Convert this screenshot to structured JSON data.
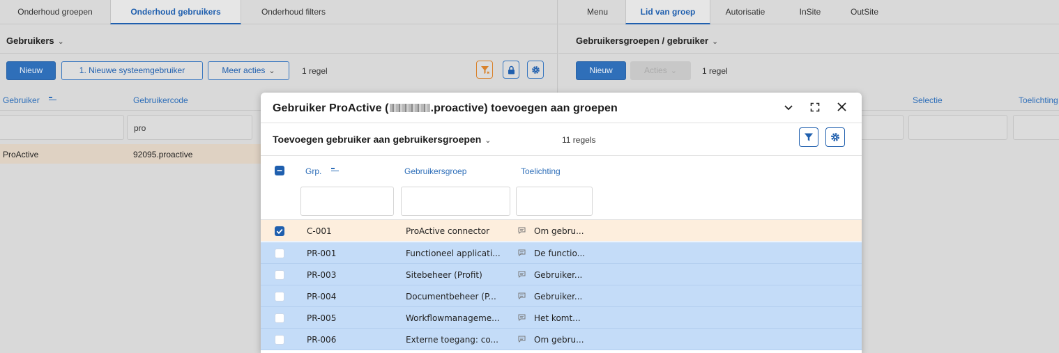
{
  "left_pane": {
    "tabs": [
      "Onderhoud groepen",
      "Onderhoud gebruikers",
      "Onderhoud filters"
    ],
    "active_tab": "Onderhoud gebruikers",
    "section_title": "Gebruikers",
    "toolbar": {
      "new_label": "Nieuw",
      "new_system_user_label": "1. Nieuwe systeemgebruiker",
      "more_actions_label": "Meer acties",
      "row_count": "1 regel"
    },
    "columns": [
      "Gebruiker",
      "Gebruikercode"
    ],
    "filter_value": "pro",
    "rows": [
      {
        "user": "ProActive",
        "code": "92095.proactive"
      }
    ]
  },
  "right_pane": {
    "tabs": [
      "Menu",
      "Lid van groep",
      "Autorisatie",
      "InSite",
      "OutSite"
    ],
    "active_tab": "Lid van groep",
    "section_title": "Gebruikersgroepen / gebruiker",
    "toolbar": {
      "new_label": "Nieuw",
      "actions_label": "Acties",
      "row_count": "1 regel"
    },
    "columns": [
      "Selectie",
      "Toelichting"
    ]
  },
  "modal": {
    "title_prefix": "Gebruiker ProActive (",
    "title_suffix": ".proactive) toevoegen aan groepen",
    "subtitle": "Toevoegen gebruiker aan gebruikersgroepen",
    "row_count": "11 regels",
    "columns": {
      "grp": "Grp.",
      "group": "Gebruikersgroep",
      "note": "Toelichting"
    },
    "rows": [
      {
        "grp": "C-001",
        "group": "ProActive connector",
        "note": "Om gebru...",
        "checked": true
      },
      {
        "grp": "PR-001",
        "group": "Functioneel applicati...",
        "note": "De functio...",
        "checked": false
      },
      {
        "grp": "PR-003",
        "group": "Sitebeheer (Profit)",
        "note": "Gebruiker...",
        "checked": false
      },
      {
        "grp": "PR-004",
        "group": "Documentbeheer (P...",
        "note": "Gebruiker...",
        "checked": false
      },
      {
        "grp": "PR-005",
        "group": "Workflowmanageme...",
        "note": "Het komt...",
        "checked": false
      },
      {
        "grp": "PR-006",
        "group": "Externe toegang: co...",
        "note": "Om gebru...",
        "checked": false
      }
    ]
  },
  "colors": {
    "accent": "#1f5fae",
    "selected_row": "#fdeedd",
    "highlight_row": "#c4dcf8",
    "filter_icon_border": "#d9822b"
  }
}
